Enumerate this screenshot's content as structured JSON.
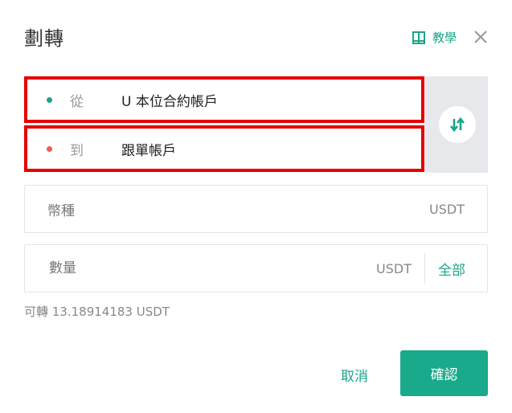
{
  "dialog": {
    "title": "劃轉",
    "tutorial_label": "教學"
  },
  "transfer": {
    "from": {
      "label": "從",
      "account": "U 本位合約帳戶",
      "dot_color": "#1aa58a"
    },
    "to": {
      "label": "到",
      "account": "跟單帳戶",
      "dot_color": "#f05a5a"
    }
  },
  "coin_field": {
    "label": "幣種",
    "unit": "USDT"
  },
  "amount_field": {
    "placeholder": "數量",
    "unit": "USDT",
    "all_label": "全部"
  },
  "available_text": "可轉 13.18914183 USDT",
  "actions": {
    "cancel_label": "取消",
    "confirm_label": "確認"
  },
  "colors": {
    "accent": "#1aa58a",
    "highlight": "#e60000"
  }
}
